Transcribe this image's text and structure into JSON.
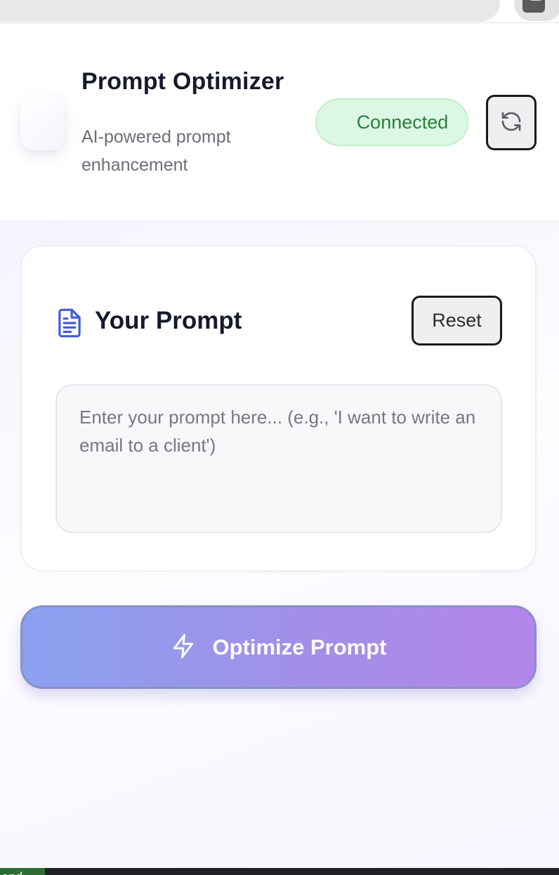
{
  "browser": {
    "toolbar_icons": [
      "display-icon",
      "star-icon",
      "profile-icon"
    ]
  },
  "header": {
    "title": "Prompt Optimizer",
    "subtitle": "AI-powered prompt enhancement",
    "status": "Connected",
    "refresh_icon": "refresh-icon"
  },
  "prompt_card": {
    "icon": "document-icon",
    "title": "Your Prompt",
    "reset_label": "Reset",
    "input_value": "",
    "input_placeholder": "Enter your prompt here... (e.g., 'I want to write an email to a client')"
  },
  "optimize": {
    "icon": "lightning-icon",
    "label": "Optimize Prompt"
  },
  "taskbar": {
    "item_label": "ond"
  },
  "colors": {
    "accent_start": "#8aa1f0",
    "accent_end": "#b485ea",
    "status_bg": "#dcf8e4",
    "status_text": "#2b7d3d",
    "icon_blue": "#3b5bdb"
  }
}
